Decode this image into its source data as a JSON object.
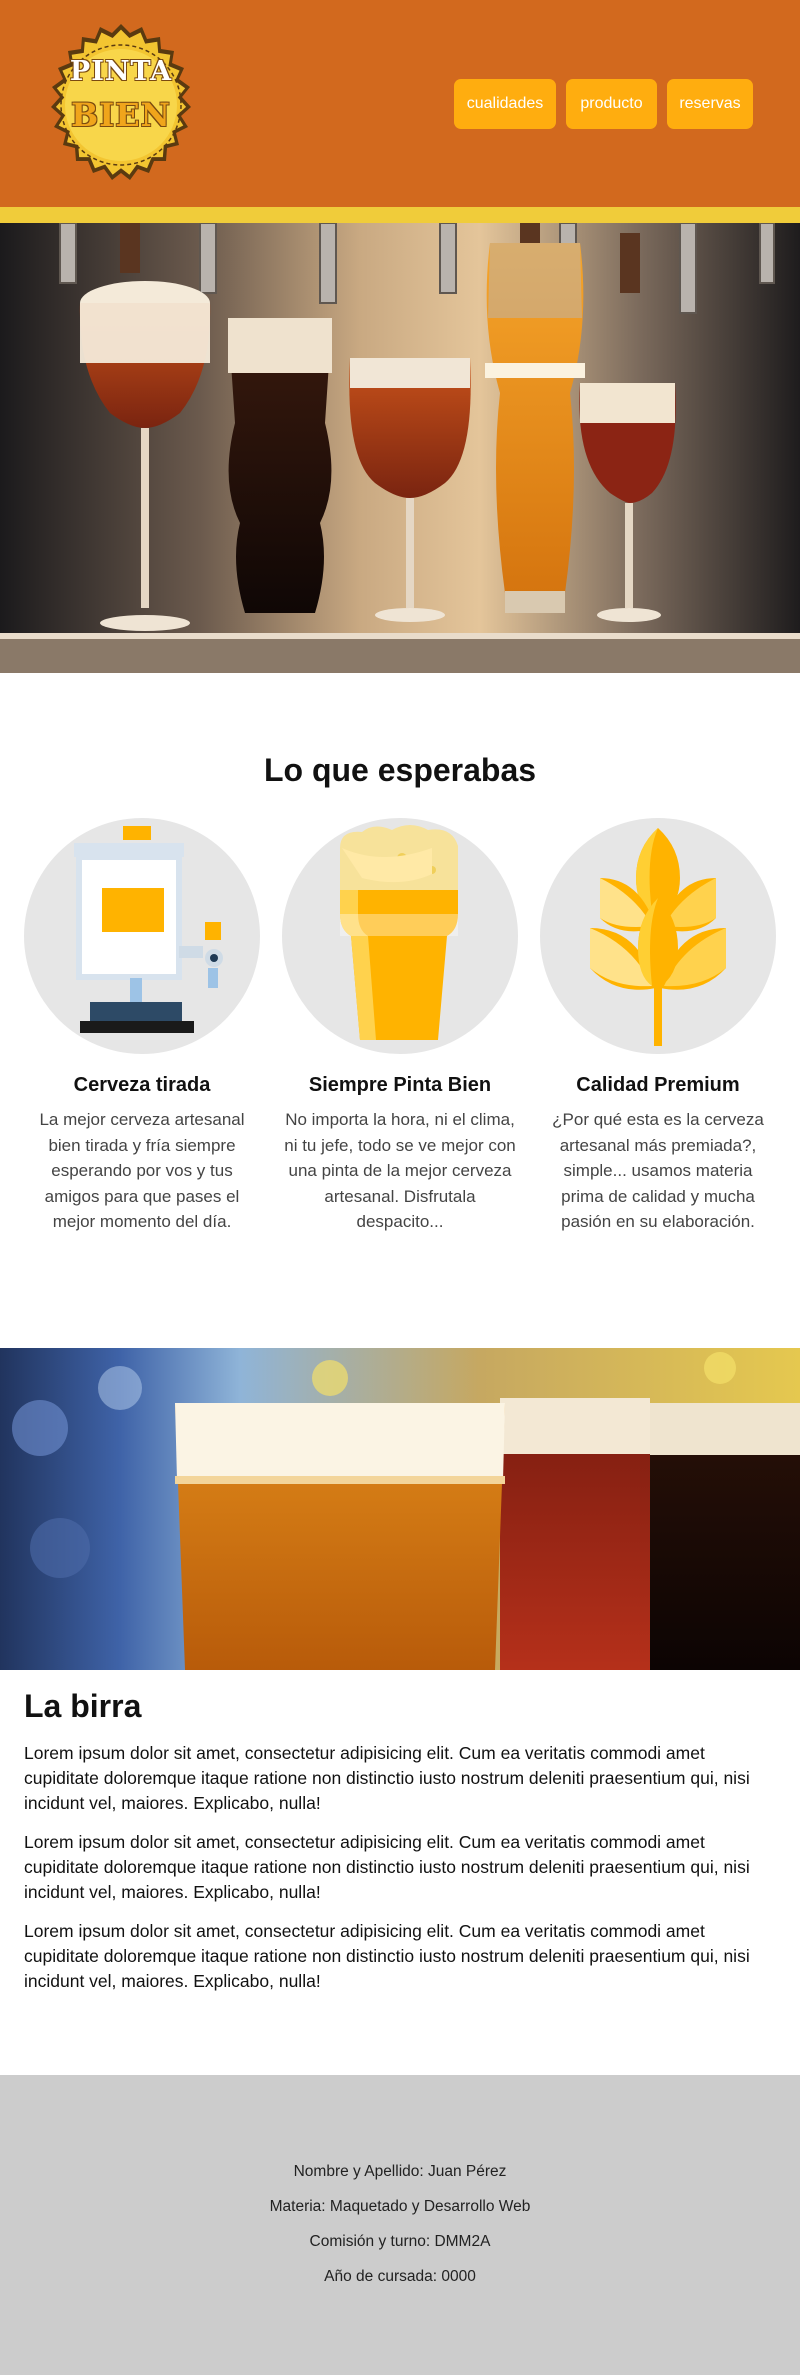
{
  "header": {
    "logo_line1": "PINTA",
    "logo_line2": "BIEN",
    "nav": [
      "cualidades",
      "producto",
      "reservas"
    ]
  },
  "features": {
    "title": "Lo que esperabas",
    "items": [
      {
        "icon": "tap-dispenser-icon",
        "title": "Cerveza tirada",
        "text": "La mejor cerveza artesanal bien tirada y fría siempre esperando por vos y tus amigos para que pases el mejor momento del día."
      },
      {
        "icon": "beer-pint-icon",
        "title": "Siempre Pinta Bien",
        "text": "No importa la hora, ni el clima, ni tu jefe, todo se ve mejor con una pinta de la mejor cerveza artesanal. Disfrutala despacito..."
      },
      {
        "icon": "wheat-icon",
        "title": "Calidad Premium",
        "text": "¿Por qué esta es la cerveza artesanal más premiada?, simple... usamos materia prima de calidad y mucha pasión en su elaboración."
      }
    ]
  },
  "birra": {
    "title": "La birra",
    "paragraphs": [
      "Lorem ipsum dolor sit amet, consectetur adipisicing elit. Cum ea veritatis commodi amet cupiditate doloremque itaque ratione non distinctio iusto nostrum deleniti praesentium qui, nisi incidunt vel, maiores. Explicabo, nulla!",
      "Lorem ipsum dolor sit amet, consectetur adipisicing elit. Cum ea veritatis commodi amet cupiditate doloremque itaque ratione non distinctio iusto nostrum deleniti praesentium qui, nisi incidunt vel, maiores. Explicabo, nulla!",
      "Lorem ipsum dolor sit amet, consectetur adipisicing elit. Cum ea veritatis commodi amet cupiditate doloremque itaque ratione non distinctio iusto nostrum deleniti praesentium qui, nisi incidunt vel, maiores. Explicabo, nulla!"
    ]
  },
  "footer": {
    "lines": [
      "Nombre y Apellido: Juan Pérez",
      "Materia: Maquetado y Desarrollo Web",
      "Comisión y turno: DMM2A",
      "Año de cursada: 0000"
    ]
  },
  "colors": {
    "header_bg": "#d2691e",
    "stripe": "#f0cc3a",
    "nav_button": "#ffad0f",
    "footer_bg": "#cccccc",
    "circle_bg": "#e6e6e6"
  }
}
